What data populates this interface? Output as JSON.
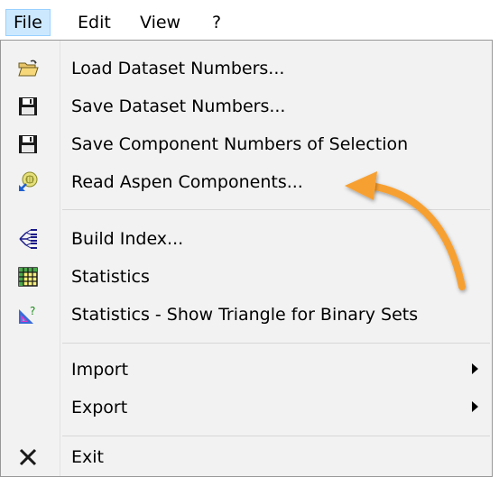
{
  "menubar": {
    "items": [
      {
        "label": "File"
      },
      {
        "label": "Edit"
      },
      {
        "label": "View"
      },
      {
        "label": "?"
      }
    ]
  },
  "menu": {
    "items": [
      {
        "label": "Load Dataset Numbers...",
        "icon": "folder-open-icon"
      },
      {
        "label": "Save Dataset Numbers...",
        "icon": "floppy-disk-icon"
      },
      {
        "label": "Save Component Numbers of Selection",
        "icon": "floppy-disk-icon"
      },
      {
        "label": "Read Aspen Components...",
        "icon": "aspen-import-icon"
      },
      {
        "label": "Build Index...",
        "icon": "tree-index-icon"
      },
      {
        "label": "Statistics",
        "icon": "grid-table-icon"
      },
      {
        "label": "Statistics - Show Triangle for Binary Sets",
        "icon": "triangle-question-icon"
      },
      {
        "label": "Import",
        "icon": "submenu-arrow"
      },
      {
        "label": "Export",
        "icon": "submenu-arrow"
      },
      {
        "label": "Exit",
        "icon": "close-x-icon"
      }
    ]
  },
  "colors": {
    "menu_bg": "#f2f2f2",
    "active_highlight": "#cce8ff",
    "annotation_arrow": "#f7a030"
  }
}
